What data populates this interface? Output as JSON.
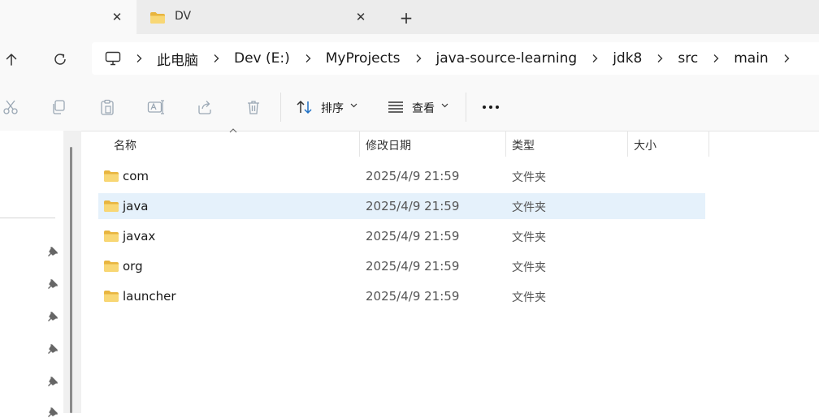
{
  "tabs": [
    {
      "title": ""
    },
    {
      "title": "DV"
    }
  ],
  "breadcrumb": [
    "此电脑",
    "Dev (E:)",
    "MyProjects",
    "java-source-learning",
    "jdk8",
    "src",
    "main"
  ],
  "command_bar": {
    "sort_label": "排序",
    "view_label": "查看"
  },
  "columns": {
    "name": "名称",
    "date": "修改日期",
    "type": "类型",
    "size": "大小"
  },
  "files": [
    {
      "name": "com",
      "date": "2025/4/9 21:59",
      "type": "文件夹",
      "size": ""
    },
    {
      "name": "java",
      "date": "2025/4/9 21:59",
      "type": "文件夹",
      "size": ""
    },
    {
      "name": "javax",
      "date": "2025/4/9 21:59",
      "type": "文件夹",
      "size": ""
    },
    {
      "name": "org",
      "date": "2025/4/9 21:59",
      "type": "文件夹",
      "size": ""
    },
    {
      "name": "launcher",
      "date": "2025/4/9 21:59",
      "type": "文件夹",
      "size": ""
    }
  ],
  "selected_row": "java",
  "colors": {
    "accent_selection": "#e5f1fb",
    "folder_yellow": "#f8d775",
    "folder_dark": "#e8b53f"
  }
}
